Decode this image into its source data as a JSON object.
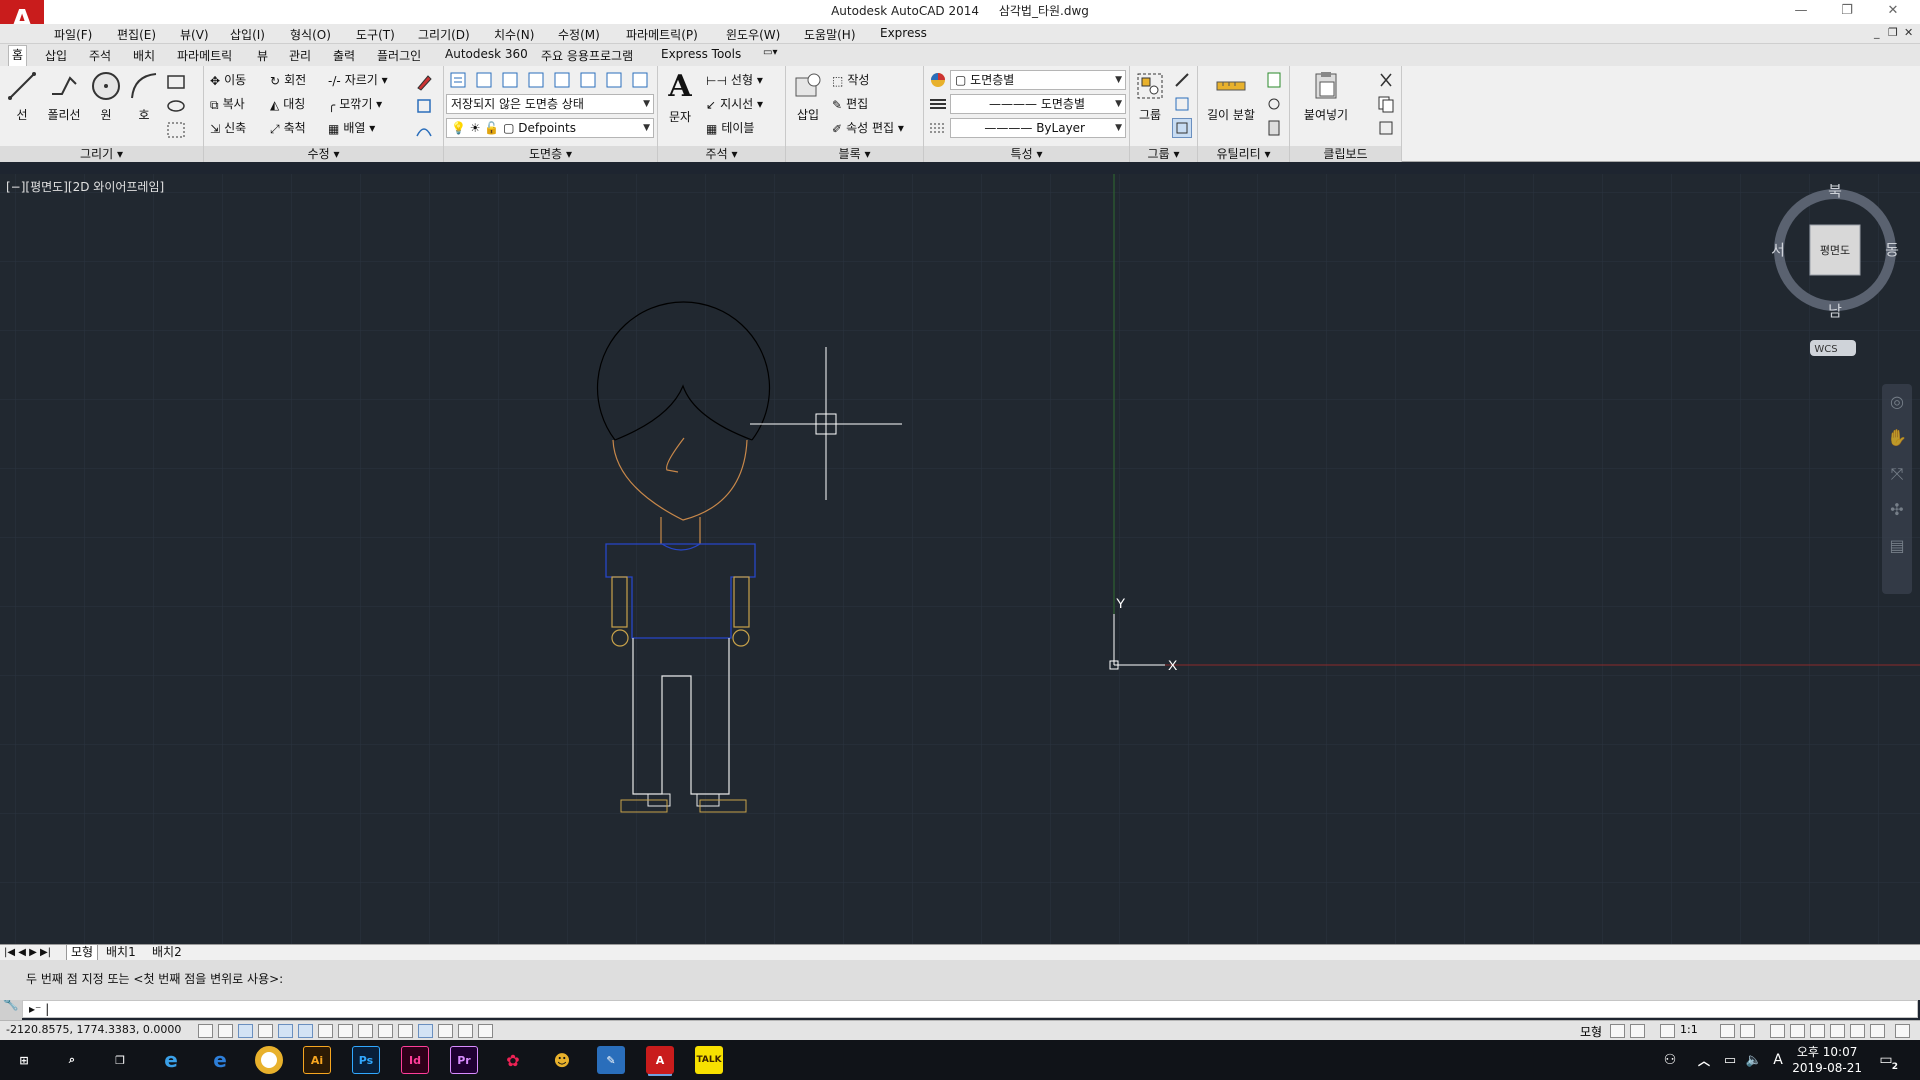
{
  "app": {
    "title": "Autodesk AutoCAD 2014",
    "file_name": "삼각법_타원.dwg",
    "logo_letter": "A"
  },
  "menubar": [
    "파일(F)",
    "편집(E)",
    "뷰(V)",
    "삽입(I)",
    "형식(O)",
    "도구(T)",
    "그리기(D)",
    "치수(N)",
    "수정(M)",
    "파라메트릭(P)",
    "윈도우(W)",
    "도움말(H)",
    "Express"
  ],
  "ribbon_tabs": [
    "홈",
    "삽입",
    "주석",
    "배치",
    "파라메트릭",
    "뷰",
    "관리",
    "출력",
    "플러그인",
    "Autodesk 360",
    "주요 응용프로그램",
    "Express Tools"
  ],
  "ribbon": {
    "draw": {
      "title": "그리기",
      "line": "선",
      "polyline": "폴리선",
      "circle": "원",
      "arc": "호"
    },
    "modify": {
      "title": "수정",
      "move": "이동",
      "rotate": "회전",
      "trim": "자르기",
      "copy": "복사",
      "mirror": "대칭",
      "fillet": "모깎기",
      "stretch": "신축",
      "scale": "축척",
      "array": "배열"
    },
    "layers": {
      "title": "도면층",
      "layer_state": "저장되지 않은 도면층 상태",
      "current_layer": "Defpoints"
    },
    "annotation": {
      "title": "주석",
      "text": "문자",
      "linear": "선형",
      "leader": "지시선",
      "table": "테이블"
    },
    "block": {
      "title": "블록",
      "insert": "삽입",
      "create": "작성",
      "edit": "편집",
      "attr_edit": "속성 편집"
    },
    "properties": {
      "title": "특성",
      "color": "도면층별",
      "linetype": "도면층별",
      "lineweight": "ByLayer"
    },
    "groups": {
      "title": "그룹",
      "group": "그룹"
    },
    "utilities": {
      "title": "유틸리티",
      "measure": "길이 분할"
    },
    "clipboard": {
      "title": "클립보드",
      "paste": "붙여넣기"
    }
  },
  "viewport": {
    "label": "[−][평면도][2D 와이어프레임]"
  },
  "viewcube": {
    "north": "북",
    "south": "남",
    "east": "동",
    "west": "서",
    "face": "평면도",
    "wcs": "WCS"
  },
  "ucs": {
    "x": "X",
    "y": "Y"
  },
  "layout_tabs": [
    "모형",
    "배치1",
    "배치2"
  ],
  "command": {
    "history": "두 번째 점 지정 또는 <첫 번째 점을 변위로 사용>:",
    "prompt": ""
  },
  "status": {
    "coords": "-2120.8575, 1774.3383, 0.0000",
    "model": "모형",
    "scale": "1:1"
  },
  "taskbar": {
    "time": "오후 10:07",
    "date": "2019-08-21",
    "notifications": "2",
    "ime": "A"
  },
  "colors": {
    "canvas_bg": "#212830",
    "grid": "#2b3440",
    "ucs_x_axis": "#8a2a2a",
    "ucs_y_axis": "#2f6b2f",
    "accent": "#c91c1c"
  }
}
